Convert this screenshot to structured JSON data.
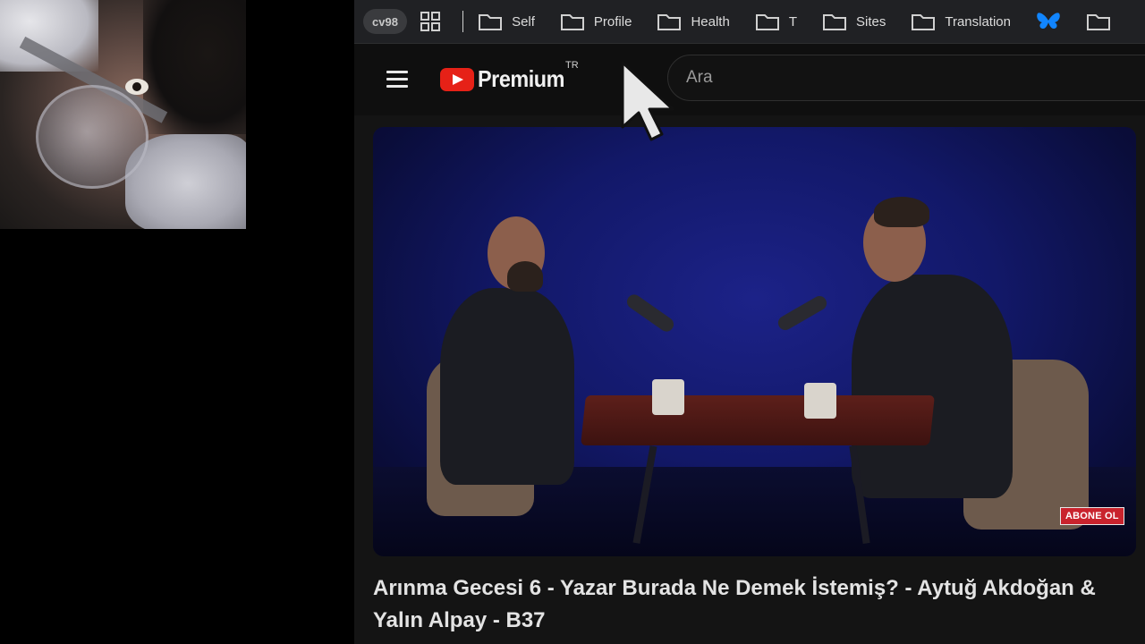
{
  "bookmarks_bar": {
    "profile_label": "cv98",
    "apps_icon": "apps-grid-icon",
    "items": [
      {
        "label": "Self",
        "icon": "folder-icon"
      },
      {
        "label": "Profile",
        "icon": "folder-icon"
      },
      {
        "label": "Health",
        "icon": "folder-icon"
      },
      {
        "label": "T",
        "icon": "folder-icon"
      },
      {
        "label": "Sites",
        "icon": "folder-icon"
      },
      {
        "label": "Translation",
        "icon": "folder-icon"
      }
    ],
    "bluesky_icon": "butterfly-icon"
  },
  "youtube": {
    "logo_text": "Premium",
    "region": "TR",
    "search_placeholder": "Ara",
    "video": {
      "overlay_badge": "ABONE OL",
      "title": "Arınma Gecesi 6 - Yazar Burada Ne Demek İstemiş? - Aytuğ Akdoğan & Yalın Alpay - B37"
    }
  },
  "colors": {
    "accent_red": "#e62117",
    "bookmarks_bg": "#202124",
    "page_bg": "#0f0f0f",
    "bluesky_blue": "#1185fe"
  }
}
